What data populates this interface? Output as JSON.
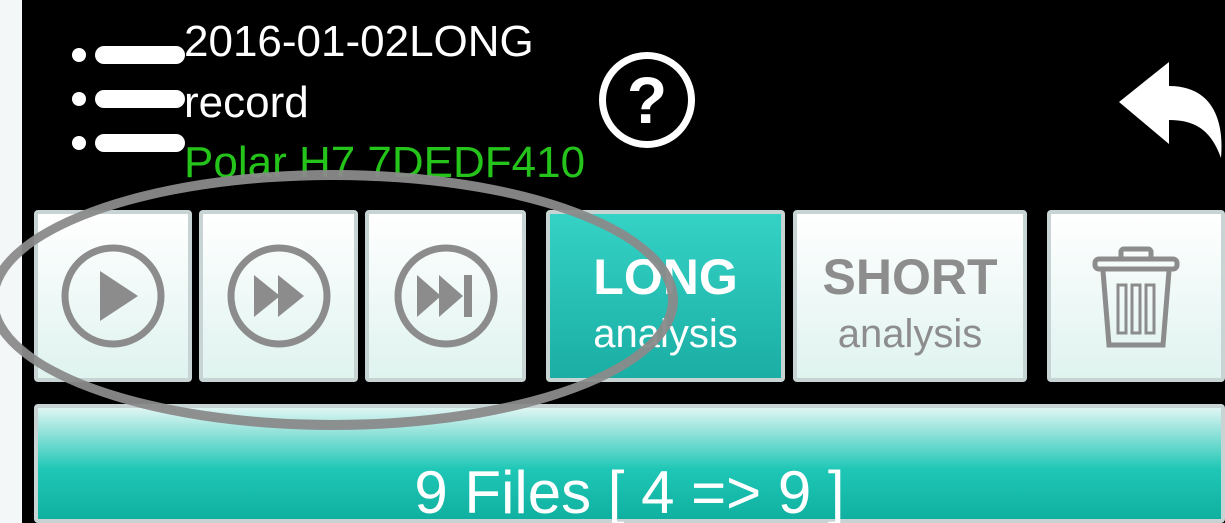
{
  "header": {
    "title_line1": "2016-01-02LONG",
    "title_line2": "record",
    "device": "Polar H7 7DEDF410"
  },
  "icons": {
    "menu": "menu-list-icon",
    "help": "question-mark-icon",
    "back": "back-arrow-icon",
    "play": "play-icon",
    "fast_forward": "fast-forward-icon",
    "skip_next": "skip-next-icon",
    "delete": "trash-icon"
  },
  "buttons": {
    "help_symbol": "?",
    "long_title": "LONG",
    "long_sub": "analysis",
    "short_title": "SHORT",
    "short_sub": "analysis"
  },
  "files": {
    "label": "9 Files [ 4 => 9 ]"
  },
  "colors": {
    "accent": "#1aaea4",
    "device_text": "#25c41b",
    "background": "#000000",
    "highlight_ring": "#8a8a8a"
  }
}
